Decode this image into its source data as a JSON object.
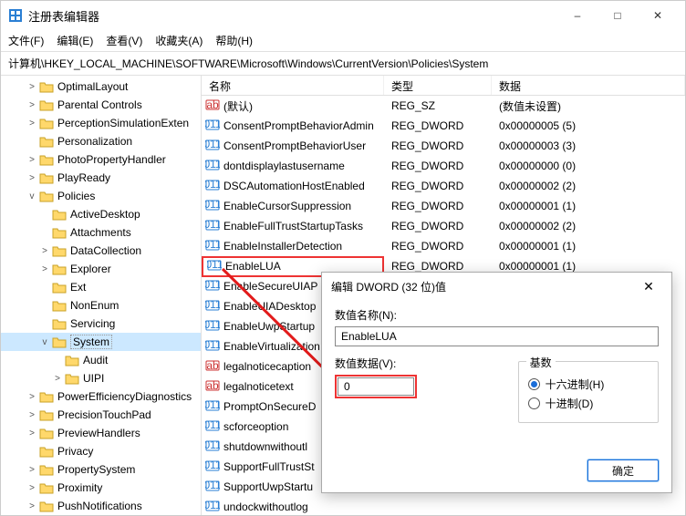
{
  "window": {
    "title": "注册表编辑器"
  },
  "menu": [
    "文件(F)",
    "编辑(E)",
    "查看(V)",
    "收藏夹(A)",
    "帮助(H)"
  ],
  "address": "计算机\\HKEY_LOCAL_MACHINE\\SOFTWARE\\Microsoft\\Windows\\CurrentVersion\\Policies\\System",
  "tree": [
    {
      "indent": 2,
      "twisty": ">",
      "label": "OptimalLayout"
    },
    {
      "indent": 2,
      "twisty": ">",
      "label": "Parental Controls"
    },
    {
      "indent": 2,
      "twisty": ">",
      "label": "PerceptionSimulationExten"
    },
    {
      "indent": 2,
      "twisty": "",
      "label": "Personalization"
    },
    {
      "indent": 2,
      "twisty": ">",
      "label": "PhotoPropertyHandler"
    },
    {
      "indent": 2,
      "twisty": ">",
      "label": "PlayReady"
    },
    {
      "indent": 2,
      "twisty": "v",
      "label": "Policies"
    },
    {
      "indent": 3,
      "twisty": "",
      "label": "ActiveDesktop"
    },
    {
      "indent": 3,
      "twisty": "",
      "label": "Attachments"
    },
    {
      "indent": 3,
      "twisty": ">",
      "label": "DataCollection"
    },
    {
      "indent": 3,
      "twisty": ">",
      "label": "Explorer"
    },
    {
      "indent": 3,
      "twisty": "",
      "label": "Ext"
    },
    {
      "indent": 3,
      "twisty": "",
      "label": "NonEnum"
    },
    {
      "indent": 3,
      "twisty": "",
      "label": "Servicing"
    },
    {
      "indent": 3,
      "twisty": "v",
      "label": "System",
      "selected": true
    },
    {
      "indent": 4,
      "twisty": "",
      "label": "Audit"
    },
    {
      "indent": 4,
      "twisty": ">",
      "label": "UIPI"
    },
    {
      "indent": 2,
      "twisty": ">",
      "label": "PowerEfficiencyDiagnostics"
    },
    {
      "indent": 2,
      "twisty": ">",
      "label": "PrecisionTouchPad"
    },
    {
      "indent": 2,
      "twisty": ">",
      "label": "PreviewHandlers"
    },
    {
      "indent": 2,
      "twisty": "",
      "label": "Privacy"
    },
    {
      "indent": 2,
      "twisty": ">",
      "label": "PropertySystem"
    },
    {
      "indent": 2,
      "twisty": ">",
      "label": "Proximity"
    },
    {
      "indent": 2,
      "twisty": ">",
      "label": "PushNotifications"
    }
  ],
  "columns": {
    "name": "名称",
    "type": "类型",
    "data": "数据"
  },
  "rows": [
    {
      "icon": "str",
      "name": "(默认)",
      "type": "REG_SZ",
      "data": "(数值未设置)"
    },
    {
      "icon": "dword",
      "name": "ConsentPromptBehaviorAdmin",
      "type": "REG_DWORD",
      "data": "0x00000005 (5)"
    },
    {
      "icon": "dword",
      "name": "ConsentPromptBehaviorUser",
      "type": "REG_DWORD",
      "data": "0x00000003 (3)"
    },
    {
      "icon": "dword",
      "name": "dontdisplaylastusername",
      "type": "REG_DWORD",
      "data": "0x00000000 (0)"
    },
    {
      "icon": "dword",
      "name": "DSCAutomationHostEnabled",
      "type": "REG_DWORD",
      "data": "0x00000002 (2)"
    },
    {
      "icon": "dword",
      "name": "EnableCursorSuppression",
      "type": "REG_DWORD",
      "data": "0x00000001 (1)"
    },
    {
      "icon": "dword",
      "name": "EnableFullTrustStartupTasks",
      "type": "REG_DWORD",
      "data": "0x00000002 (2)"
    },
    {
      "icon": "dword",
      "name": "EnableInstallerDetection",
      "type": "REG_DWORD",
      "data": "0x00000001 (1)"
    },
    {
      "icon": "dword",
      "name": "EnableLUA",
      "type": "REG_DWORD",
      "data": "0x00000001 (1)",
      "highlight": true
    },
    {
      "icon": "dword",
      "name": "EnableSecureUIAP",
      "type": "",
      "data": ""
    },
    {
      "icon": "dword",
      "name": "EnableUIADesktop",
      "type": "",
      "data": ""
    },
    {
      "icon": "dword",
      "name": "EnableUwpStartup",
      "type": "",
      "data": ""
    },
    {
      "icon": "dword",
      "name": "EnableVirtualization",
      "type": "",
      "data": ""
    },
    {
      "icon": "str",
      "name": "legalnoticecaption",
      "type": "",
      "data": ""
    },
    {
      "icon": "str",
      "name": "legalnoticetext",
      "type": "",
      "data": ""
    },
    {
      "icon": "dword",
      "name": "PromptOnSecureD",
      "type": "",
      "data": ""
    },
    {
      "icon": "dword",
      "name": "scforceoption",
      "type": "",
      "data": ""
    },
    {
      "icon": "dword",
      "name": "shutdownwithoutl",
      "type": "",
      "data": ""
    },
    {
      "icon": "dword",
      "name": "SupportFullTrustSt",
      "type": "",
      "data": ""
    },
    {
      "icon": "dword",
      "name": "SupportUwpStartu",
      "type": "",
      "data": ""
    },
    {
      "icon": "dword",
      "name": "undockwithoutlog",
      "type": "",
      "data": ""
    }
  ],
  "dialog": {
    "title": "编辑 DWORD (32 位)值",
    "name_label": "数值名称(N):",
    "name_value": "EnableLUA",
    "data_label": "数值数据(V):",
    "data_value": "0",
    "radix_label": "基数",
    "radix_hex": "十六进制(H)",
    "radix_dec": "十进制(D)",
    "ok": "确定"
  }
}
